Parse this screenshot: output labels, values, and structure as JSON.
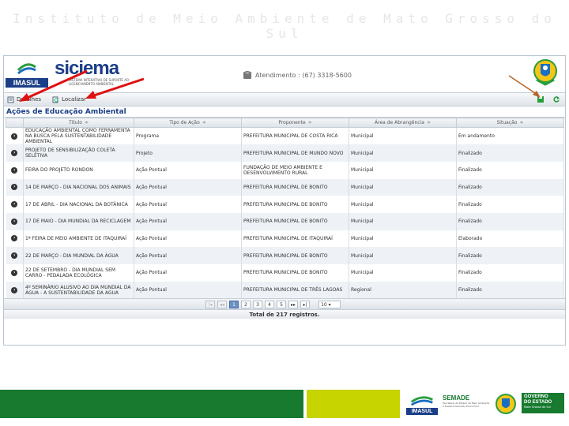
{
  "slide": {
    "title": "Instituto de Meio Ambiente de Mato Grosso do Sul"
  },
  "header": {
    "imasul_logo_text": "IMASUL",
    "siciema_logo_text": "siciema",
    "siciema_subtitle": "SISTEMA INTERATIVO DE SUPORTE AO LICENCIAMENTO AMBIENTAL",
    "phone_text": "Atendimento : (67) 3318-5600"
  },
  "toolbar": {
    "details_label": "Detalhes",
    "search_label": "Localizar"
  },
  "panel": {
    "title": "Ações de Educação Ambiental"
  },
  "table": {
    "columns": [
      "Título",
      "Tipo de Ação",
      "Proponente",
      "Área de Abrangência",
      "Situação"
    ],
    "rows": [
      {
        "titulo": "EDUCAÇÃO AMBIENTAL COMO FERRAMENTA NA BUSCA PELA SUSTENTABILIDADE AMBIENTAL",
        "tipo": "Programa",
        "proponente": "PREFEITURA MUNICIPAL DE COSTA RICA",
        "area": "Municipal",
        "situacao": "Em andamento"
      },
      {
        "titulo": "PROJETO DE SENSIBILIZAÇÃO COLETA SELETIVA",
        "tipo": "Projeto",
        "proponente": "PREFEITURA MUNICIPAL DE MUNDO NOVO",
        "area": "Municipal",
        "situacao": "Finalizado"
      },
      {
        "titulo": "FEIRA DO PROJETO RONDON",
        "tipo": "Ação Pontual",
        "proponente": "FUNDAÇÃO DE MEIO AMBIENTE E DESENVOLVIMENTO RURAL",
        "area": "Municipal",
        "situacao": "Finalizado"
      },
      {
        "titulo": "14 DE MARÇO - DIA NACIONAL DOS ANIMAIS",
        "tipo": "Ação Pontual",
        "proponente": "PREFEITURA MUNICIPAL DE BONITO",
        "area": "Municipal",
        "situacao": "Finalizado"
      },
      {
        "titulo": "17 DE ABRIL - DIA NACIONAL DA BOTÂNICA",
        "tipo": "Ação Pontual",
        "proponente": "PREFEITURA MUNICIPAL DE BONITO",
        "area": "Municipal",
        "situacao": "Finalizado"
      },
      {
        "titulo": "17 DE MAIO - DIA MUNDIAL DA RECICLAGEM",
        "tipo": "Ação Pontual",
        "proponente": "PREFEITURA MUNICIPAL DE BONITO",
        "area": "Municipal",
        "situacao": "Finalizado"
      },
      {
        "titulo": "1ª FEIRA DE MEIO AMBIENTE DE ITAQUIRAÍ",
        "tipo": "Ação Pontual",
        "proponente": "PREFEITURA MUNICIPAL DE ITAQUIRAÍ",
        "area": "Municipal",
        "situacao": "Elaborado"
      },
      {
        "titulo": "22 DE MARÇO - DIA MUNDIAL DA ÁGUA",
        "tipo": "Ação Pontual",
        "proponente": "PREFEITURA MUNICIPAL DE BONITO",
        "area": "Municipal",
        "situacao": "Finalizado"
      },
      {
        "titulo": "22 DE SETEMBRO - DIA MUNDIAL SEM CARRO - PEDALADA ECOLÓGICA",
        "tipo": "Ação Pontual",
        "proponente": "PREFEITURA MUNICIPAL DE BONITO",
        "area": "Municipal",
        "situacao": "Finalizado"
      },
      {
        "titulo": "4º SEMINÁRIO ALUSIVO AO DIA MUNDIAL DA ÁGUA - A SUSTENTABILIDADE DA ÁGUA",
        "tipo": "Ação Pontual",
        "proponente": "PREFEITURA MUNICIPAL DE TRÊS LAGOAS",
        "area": "Regional",
        "situacao": "Finalizado"
      }
    ]
  },
  "pager": {
    "pages": [
      "1",
      "2",
      "3",
      "4",
      "5"
    ],
    "current": "1",
    "page_size": "10",
    "total_text": "Total de 217 registros."
  },
  "footer": {
    "imasul_text": "IMASUL",
    "semade_text": "SEMADE",
    "semade_sub": "Secretaria de Estado de Meio Ambiente e Desenvolvimento Econômico",
    "gov_line1": "GOVERNO",
    "gov_line2": "DO ESTADO",
    "gov_line3": "Mato Grosso do Sul"
  },
  "colors": {
    "brand_blue": "#1b3e87",
    "footer_green": "#177a2f",
    "footer_lime": "#c7d400",
    "arrow_red": "#e01010",
    "arrow_brown": "#b5652a"
  }
}
